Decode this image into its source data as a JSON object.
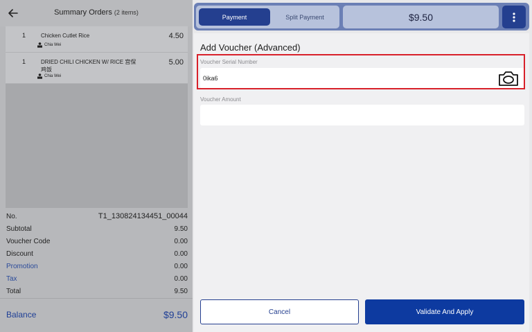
{
  "header": {
    "title": "Summary Orders",
    "count": "(2 items)"
  },
  "orders": [
    {
      "qty": "1",
      "name": "Chicken Cutlet Rice",
      "price": "4.50",
      "staff": "Chia Wei"
    },
    {
      "qty": "1",
      "name": "DRIED CHILI CHICKEN W/ RICE 宫保鸡饭",
      "price": "5.00",
      "staff": "Chia Wei"
    }
  ],
  "summary": {
    "no_label": "No.",
    "no_value": "T1_130824134451_00044",
    "subtotal_label": "Subtotal",
    "subtotal_value": "9.50",
    "voucher_label": "Voucher Code",
    "voucher_value": "0.00",
    "discount_label": "Discount",
    "discount_value": "0.00",
    "promotion_label": "Promotion",
    "promotion_value": "0.00",
    "tax_label": "Tax",
    "tax_value": "0.00",
    "total_label": "Total",
    "total_value": "9.50",
    "balance_label": "Balance",
    "balance_value": "$9.50"
  },
  "topbar": {
    "payment_tab": "Payment",
    "split_tab": "Split Payment",
    "total": "$9.50"
  },
  "voucher": {
    "title": "Add Voucher (Advanced)",
    "serial_label": "Voucher Serial Number",
    "serial_value": "0ika6",
    "amount_label": "Voucher Amount",
    "amount_value": ""
  },
  "actions": {
    "cancel": "Cancel",
    "validate": "Validate And Apply"
  },
  "colors": {
    "brand": "#243f8f",
    "highlight": "#d8202a"
  }
}
